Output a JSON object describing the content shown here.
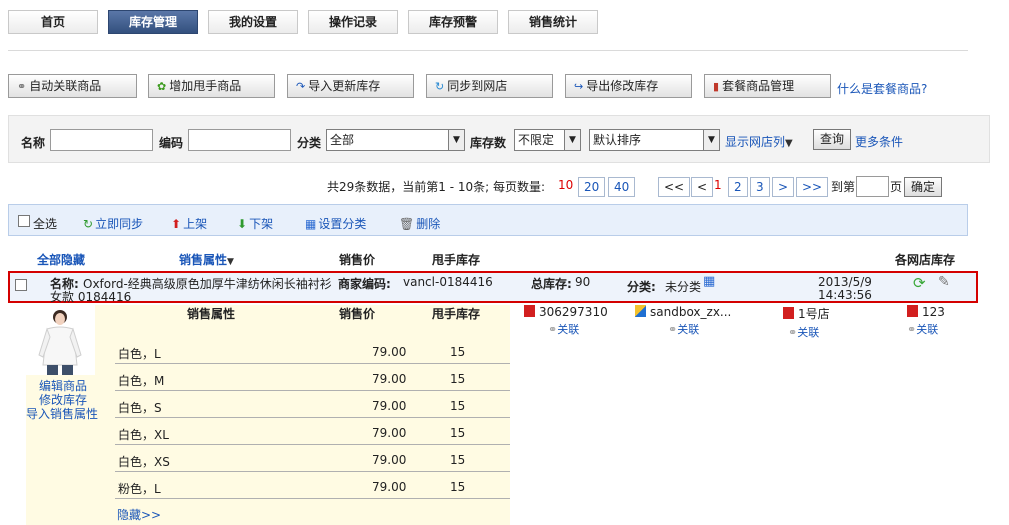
{
  "tabs": [
    {
      "label": "首页"
    },
    {
      "label": "库存管理",
      "active": true
    },
    {
      "label": "我的设置"
    },
    {
      "label": "操作记录"
    },
    {
      "label": "库存预警"
    },
    {
      "label": "销售统计"
    }
  ],
  "toolbar": {
    "auto_link": "自动关联商品",
    "add_used": "增加甩手商品",
    "import_update": "导入更新库存",
    "sync_shop": "同步到网店",
    "export_modify": "导出修改库存",
    "bundle_manage": "套餐商品管理",
    "what_is_bundle": "什么是套餐商品?"
  },
  "filter": {
    "name_label": "名称",
    "code_label": "编码",
    "category_label": "分类",
    "category_value": "全部",
    "stock_label": "库存数",
    "stock_value": "不限定",
    "sort_value": "默认排序",
    "show_shop_cols": "显示网店列",
    "query_button": "查询",
    "more_conditions": "更多条件"
  },
  "pagination": {
    "summary_prefix": "共29条数据，当前第1 - 10条; 每页数量:",
    "size_current": "10",
    "size_20": "20",
    "size_40": "40",
    "first": "<<",
    "prev": "<",
    "page1": "1",
    "page2": "2",
    "page3": "3",
    "next": ">",
    "last": ">>",
    "goto_label": "到第",
    "page_suffix": "页",
    "confirm": "确定"
  },
  "actions": {
    "select_all": "全选",
    "sync_now": "立即同步",
    "list_up": "上架",
    "list_down": "下架",
    "set_category": "设置分类",
    "delete": "删除"
  },
  "table_headers": {
    "hide_all": "全部隐藏",
    "sales_attr": "销售属性",
    "price": "销售价",
    "stock": "甩手库存",
    "shop_stock": "各网店库存"
  },
  "product": {
    "name_label": "名称:",
    "name_line1": "Oxford-经典高级原色加厚牛津纺休闲长袖衬衫",
    "name_line2": "女款 0184416",
    "merchant_code_label": "商家编码:",
    "merchant_code": "vancl-0184416",
    "total_stock_label": "总库存:",
    "total_stock": "90",
    "category_label": "分类:",
    "category": "未分类",
    "date": "2013/5/9",
    "time": "14:43:56"
  },
  "detail": {
    "edit_product": "编辑商品",
    "modify_stock": "修改库存",
    "import_attr": "导入销售属性",
    "header_attr": "销售属性",
    "header_price": "销售价",
    "header_stock": "甩手库存",
    "rows": [
      {
        "attr": "白色，L",
        "price": "79.00",
        "stock": "15"
      },
      {
        "attr": "白色，M",
        "price": "79.00",
        "stock": "15"
      },
      {
        "attr": "白色，S",
        "price": "79.00",
        "stock": "15"
      },
      {
        "attr": "白色，XL",
        "price": "79.00",
        "stock": "15"
      },
      {
        "attr": "白色，XS",
        "price": "79.00",
        "stock": "15"
      },
      {
        "attr": "粉色，L",
        "price": "79.00",
        "stock": "15"
      }
    ],
    "hide_more": "隐藏>>"
  },
  "shops": [
    {
      "name": "306297310",
      "link": "关联",
      "color": "#d21f1f"
    },
    {
      "name": "sandbox_zx...",
      "link": "关联",
      "color": "#1f6fd2"
    },
    {
      "name": "1号店",
      "link": "关联",
      "color": "#d21f1f"
    },
    {
      "name": "123",
      "link": "关联",
      "color": "#d21f1f"
    }
  ]
}
